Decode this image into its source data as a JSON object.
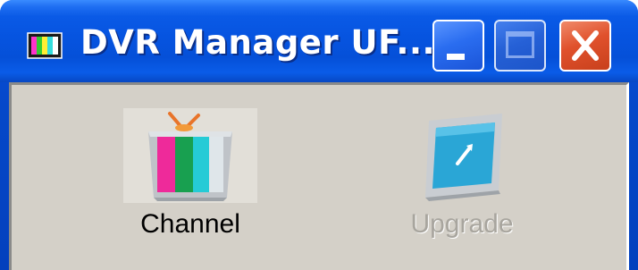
{
  "window": {
    "title": "DVR Manager UF...",
    "app_icon": "tv-icon"
  },
  "titlebar_buttons": {
    "minimize": "minimize-icon",
    "maximize": "maximize-icon",
    "close": "close-icon"
  },
  "toolbar": {
    "items": [
      {
        "label": "Channel",
        "icon": "tv-channel-icon",
        "enabled": true
      },
      {
        "label": "Upgrade",
        "icon": "upgrade-icon",
        "enabled": false
      }
    ]
  },
  "colors": {
    "titlebar_blue": "#0654e0",
    "client_bg": "#d4d0c8",
    "close_red": "#e0512c",
    "disabled_text": "#a8a59e"
  }
}
